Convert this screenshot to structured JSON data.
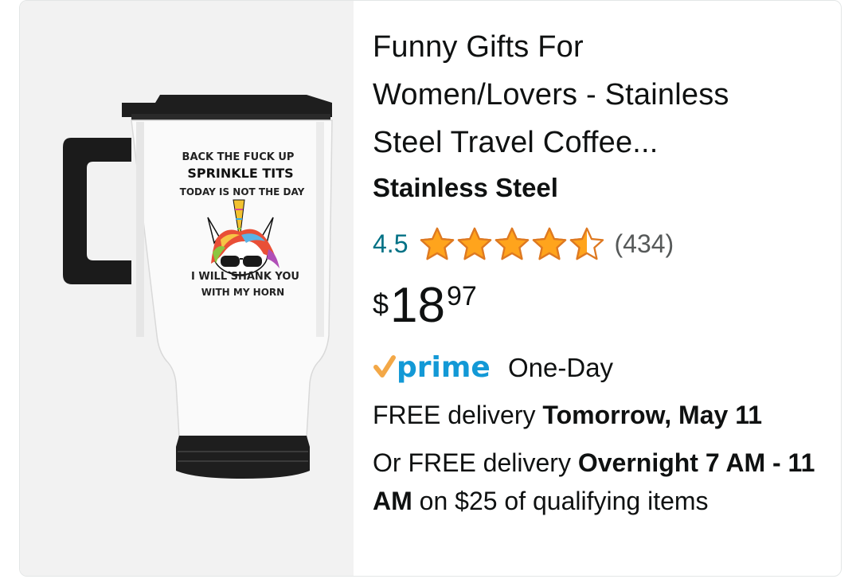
{
  "product": {
    "title_lines": [
      "Funny Gifts For",
      "Women/Lovers - Stainless",
      "Steel Travel Coffee..."
    ],
    "material": "Stainless Steel",
    "rating_value": "4.5",
    "rating_fraction": 0.9,
    "review_count": "(434)",
    "price_symbol": "$",
    "price_whole": "18",
    "price_fraction": "97",
    "prime_label": "prime",
    "prime_speed": "One-Day",
    "delivery_prefix": "FREE delivery ",
    "delivery_date": "Tomorrow, May 11",
    "alt_prefix": "Or FREE delivery ",
    "alt_window": "Overnight 7 AM - 11 AM",
    "alt_suffix": " on $25 of qualifying items"
  },
  "mug_print": {
    "line1": "BACK THE FUCK UP",
    "line2": "SPRINKLE TITS",
    "line3": "TODAY IS NOT THE DAY",
    "line4": "I WILL SHANK YOU",
    "line5": "WITH MY HORN"
  },
  "colors": {
    "star": "#ffa41c",
    "star_stroke": "#de7921",
    "link": "#007185",
    "prime_blue": "#1399d6",
    "prime_check": "#f3a847",
    "text": "#0f1111",
    "muted": "#565959"
  },
  "icons": {
    "star": "star-icon",
    "prime": "prime-logo-icon"
  }
}
